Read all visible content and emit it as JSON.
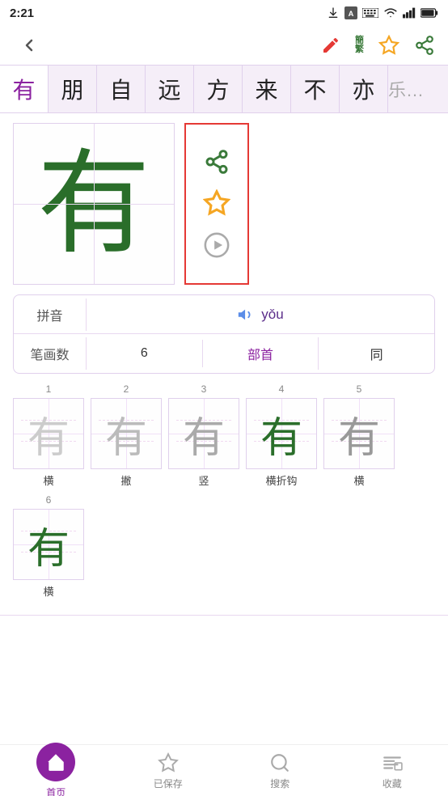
{
  "statusBar": {
    "time": "2:21",
    "icons": [
      "download-icon",
      "font-icon",
      "keyboard-icon",
      "wifi-icon",
      "signal-icon",
      "battery-icon"
    ]
  },
  "toolbar": {
    "backLabel": "←",
    "editIcon": "edit-icon",
    "simplifiedTraditionalIcon": "simplified-traditional-icon",
    "simplifiedLabel": "簡",
    "traditionalLabel": "繁",
    "favoriteIcon": "star-icon",
    "shareIcon": "share-icon"
  },
  "charStrip": {
    "characters": [
      "有",
      "朋",
      "自",
      "远",
      "方",
      "来",
      "不",
      "亦",
      "乐"
    ],
    "activeIndex": 0
  },
  "mainChar": {
    "character": "有",
    "color": "#2a6e2a"
  },
  "actionPanel": {
    "shareLabel": "share",
    "favoriteLabel": "star",
    "playLabel": "play"
  },
  "infoSection": {
    "pinyinLabel": "拼音",
    "pinyinValue": "yǒu",
    "strokeCountLabel": "笔画数",
    "strokeCountValue": "6",
    "radicalLabel": "部首",
    "sameLabel": "同"
  },
  "strokes": [
    {
      "number": "1",
      "label": "横",
      "charOpacity": "light"
    },
    {
      "number": "2",
      "label": "撇",
      "charOpacity": "light"
    },
    {
      "number": "3",
      "label": "竖",
      "charOpacity": "medium"
    },
    {
      "number": "4",
      "label": "横折钩",
      "charOpacity": "medgreen"
    },
    {
      "number": "5",
      "label": "横",
      "charOpacity": "dark"
    },
    {
      "number": "6",
      "label": "横",
      "charOpacity": "darkgreen"
    }
  ],
  "bottomNav": {
    "items": [
      {
        "id": "home",
        "label": "首页",
        "active": true
      },
      {
        "id": "saved",
        "label": "已保存",
        "active": false
      },
      {
        "id": "search",
        "label": "搜索",
        "active": false
      },
      {
        "id": "collection",
        "label": "收藏",
        "active": false
      }
    ]
  }
}
